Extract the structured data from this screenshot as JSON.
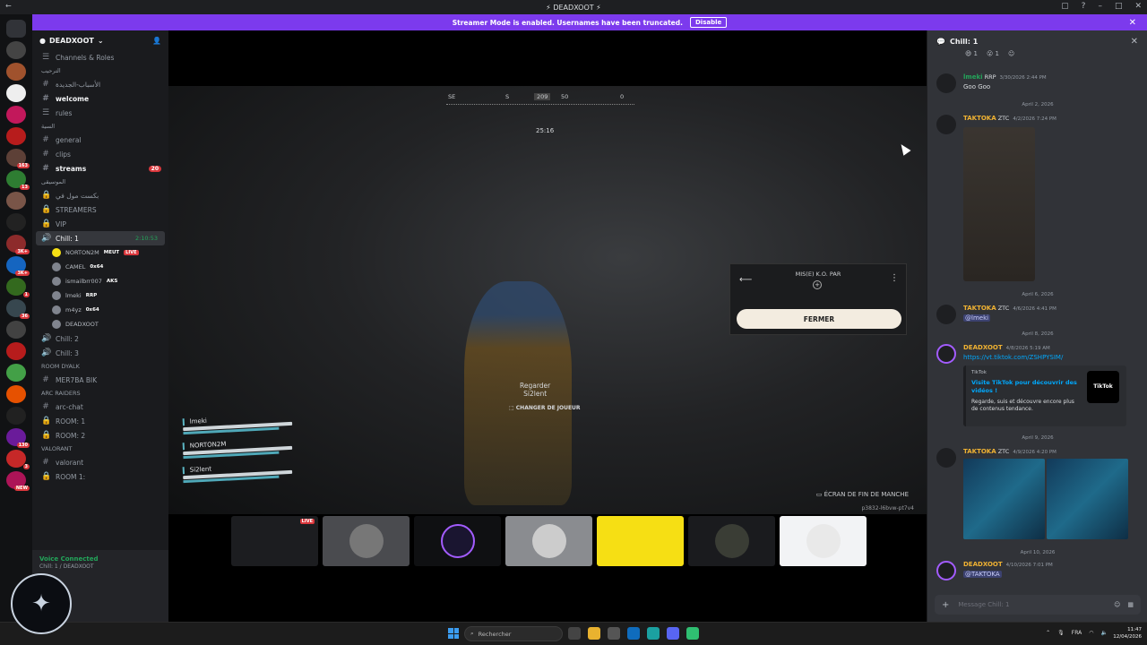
{
  "window": {
    "title": "DEADXOOT"
  },
  "banner": {
    "text": "Streamer Mode is enabled. Usernames have been truncated.",
    "button": "Disable"
  },
  "server_badges": [
    "163",
    "13",
    "3K+",
    "3K+",
    "1",
    "36",
    "130",
    "3",
    "NEW"
  ],
  "guild": {
    "name": "DEADXOOT",
    "channels_roles": "Channels & Roles"
  },
  "channels": [
    {
      "kind": "cat",
      "label": "الترحيب"
    },
    {
      "kind": "text",
      "label": "الأسباب-الجديدة"
    },
    {
      "kind": "text",
      "label": "welcome",
      "bright": true
    },
    {
      "kind": "text",
      "label": "rules"
    },
    {
      "kind": "cat",
      "label": "السية"
    },
    {
      "kind": "text",
      "label": "general"
    },
    {
      "kind": "text",
      "label": "clips"
    },
    {
      "kind": "text",
      "label": "streams",
      "bright": true,
      "count": "20"
    },
    {
      "kind": "cat",
      "label": "الموسيقى"
    },
    {
      "kind": "lock",
      "label": "بكست مول في"
    },
    {
      "kind": "lock",
      "label": "STREAMERS"
    },
    {
      "kind": "lock",
      "label": "VIP"
    }
  ],
  "voice_active": {
    "label": "Chill: 1",
    "timer": "2:10:53"
  },
  "voice_users": [
    {
      "name": "NORTON2M",
      "tag": "MEUT",
      "live": "LIVE"
    },
    {
      "name": "CAMEL",
      "tag": "0x64"
    },
    {
      "name": "ismailbrr007",
      "tag": "AKS"
    },
    {
      "name": "lmeki",
      "tag": "RRP"
    },
    {
      "name": "m4yz",
      "tag": "0x64"
    },
    {
      "name": "DEADXOOT",
      "tag": ""
    }
  ],
  "channels_after": [
    {
      "kind": "voice",
      "label": "Chill: 2"
    },
    {
      "kind": "voice",
      "label": "Chill: 3"
    },
    {
      "kind": "cat",
      "label": "ROOM DYALK"
    },
    {
      "kind": "text",
      "label": "MER7BA BIK"
    },
    {
      "kind": "cat",
      "label": "ARC RAIDERS"
    },
    {
      "kind": "text",
      "label": "arc-chat"
    },
    {
      "kind": "lock",
      "label": "ROOM: 1"
    },
    {
      "kind": "lock",
      "label": "ROOM: 2"
    },
    {
      "kind": "cat",
      "label": "VALORANT"
    },
    {
      "kind": "text",
      "label": "valorant"
    },
    {
      "kind": "lock",
      "label": "ROOM 1:"
    }
  ],
  "voice_status": {
    "title": "Voice Connected",
    "sub": "Chill: 1 / DEADXOOT"
  },
  "hud": {
    "compass": [
      "SE",
      "S",
      "209",
      "50",
      "0"
    ],
    "timer": "25:16",
    "ko_label": "MIS(E) K.O. PAR",
    "close_button": "FERMER",
    "watch": "Regarder",
    "watch_name": "Si2lent",
    "change_player": "CHANGER DE JOUEUR",
    "squad": [
      "lmeki",
      "NORTON2M",
      "Si2lent"
    ],
    "end_round": "ÉCRAN DE FIN DE MANCHE",
    "match_id": "p3832-l6bvw-pt7v4"
  },
  "stream_live": "LIVE",
  "chat": {
    "title": "Chill: 1",
    "reactions": [
      "1",
      "1"
    ],
    "messages": [
      {
        "author": "lmeki",
        "tag": "RRP",
        "time": "3/30/2026 2:44 PM",
        "body": "Goo Goo",
        "color": "#23a55a"
      },
      {
        "author": "TAKTOKA",
        "tag": "ZTC",
        "time": "4/2/2026 7:24 PM",
        "body": "",
        "color": "#f0b232"
      },
      {
        "author": "TAKTOKA",
        "tag": "ZTC",
        "time": "4/6/2026 4:41 PM",
        "body": "@lmeki",
        "color": "#f0b232"
      },
      {
        "author": "DEADXOOT",
        "tag": "",
        "time": "4/8/2026 5:19 AM",
        "body": "https://vt.tiktok.com/ZSHPYSIM/",
        "color": "#f0b232"
      },
      {
        "author": "TAKTOKA",
        "tag": "ZTC",
        "time": "4/9/2026 4:20 PM",
        "body": "",
        "color": "#f0b232"
      },
      {
        "author": "DEADXOOT",
        "tag": "",
        "time": "4/10/2026 7:01 PM",
        "body": "@TAKTOKA",
        "color": "#f0b232"
      }
    ],
    "dividers": [
      "April 2, 2026",
      "April 6, 2026",
      "April 8, 2026",
      "April 9, 2026",
      "April 10, 2026"
    ],
    "embed": {
      "provider": "TikTok",
      "title": "Visite TikTok pour découvrir des vidéos !",
      "desc": "Regarde, suis et découvre encore plus de contenus tendance.",
      "icon": "TikTok"
    },
    "placeholder": "Message Chill: 1"
  },
  "taskbar": {
    "search": "Rechercher",
    "lang": "FRA",
    "time": "11:47",
    "date": "12/04/2026"
  }
}
